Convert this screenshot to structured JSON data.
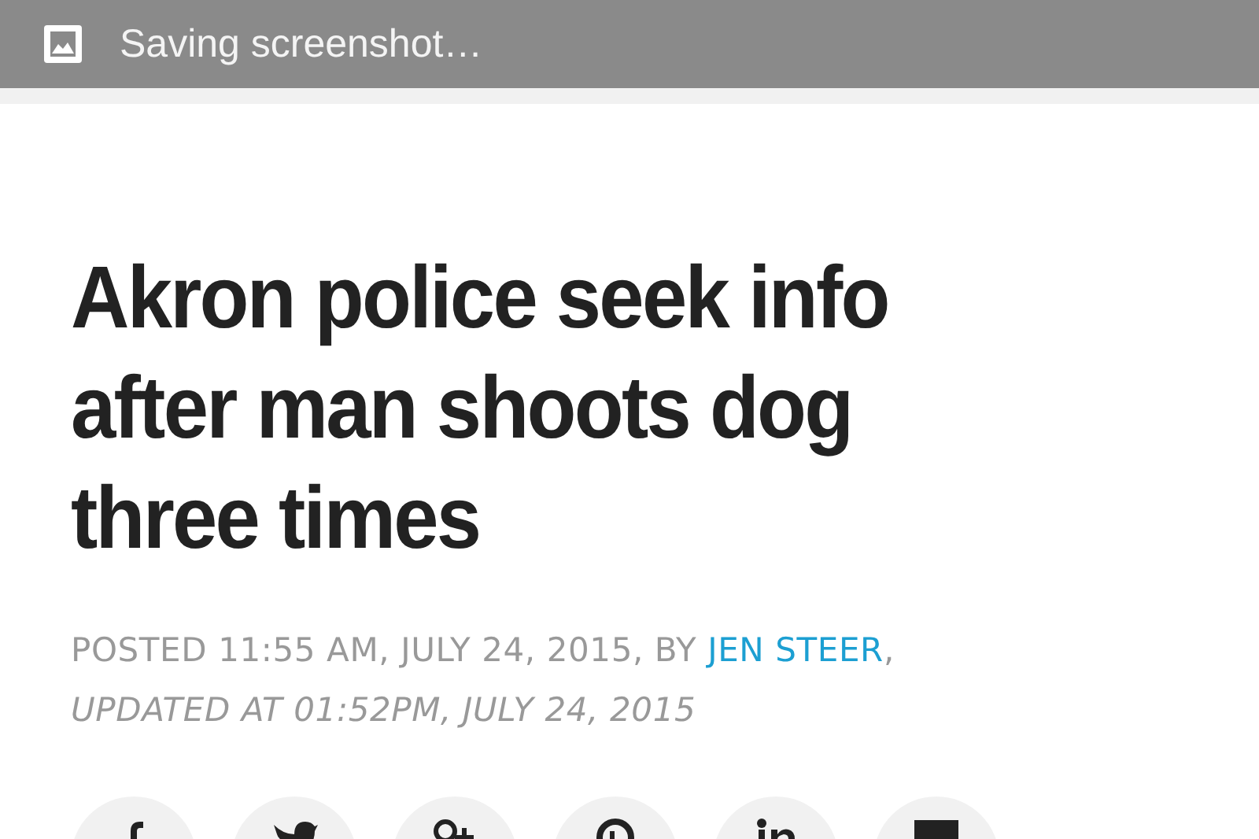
{
  "notification": {
    "text": "Saving screenshot…"
  },
  "article": {
    "headline": "Akron police seek info after man shoots dog three times",
    "byline": {
      "prefix": "POSTED 11:55 AM, JULY 24, 2015, BY ",
      "author": "JEN STEER",
      "suffix": ",",
      "updated": "UPDATED AT 01:52PM, JULY 24, 2015"
    }
  },
  "share_buttons": [
    {
      "kind": "facebook"
    },
    {
      "kind": "twitter"
    },
    {
      "kind": "googleplus"
    },
    {
      "kind": "pinterest"
    },
    {
      "kind": "linkedin"
    },
    {
      "kind": "email"
    }
  ]
}
